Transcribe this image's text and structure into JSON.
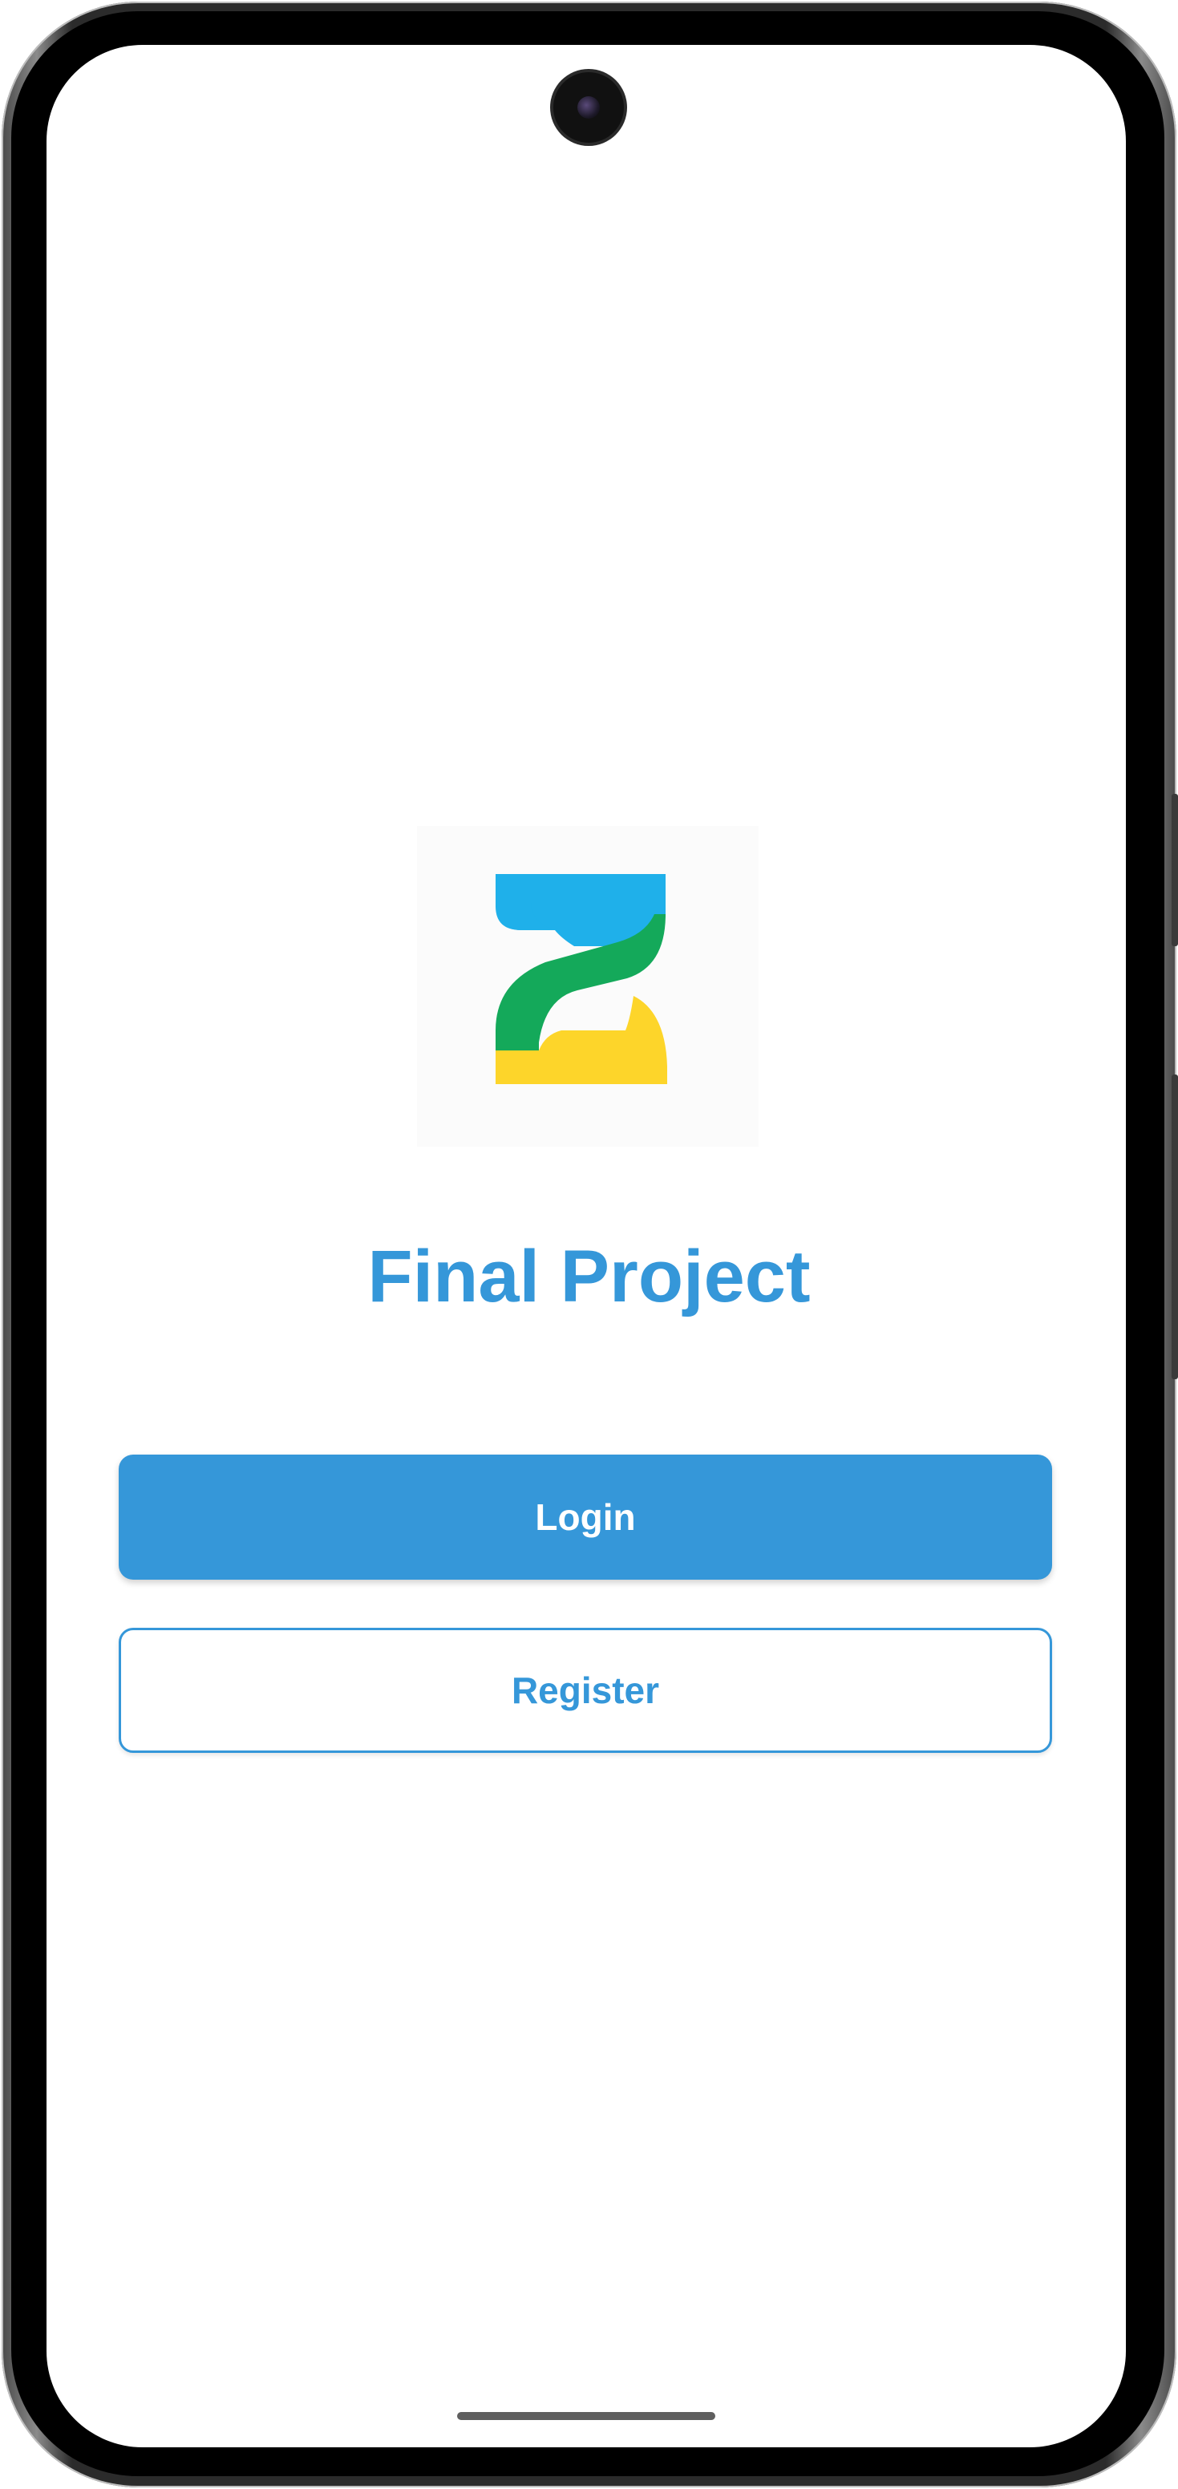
{
  "app": {
    "title": "Final Project"
  },
  "logo": {
    "icon": "hourglass-logo-icon",
    "colors": {
      "top": "#1fb0ea",
      "middle": "#14a95a",
      "bottom": "#fdd52a"
    }
  },
  "actions": {
    "login_label": "Login",
    "register_label": "Register"
  },
  "theme": {
    "accent": "#3597d9",
    "background": "#ffffff"
  }
}
